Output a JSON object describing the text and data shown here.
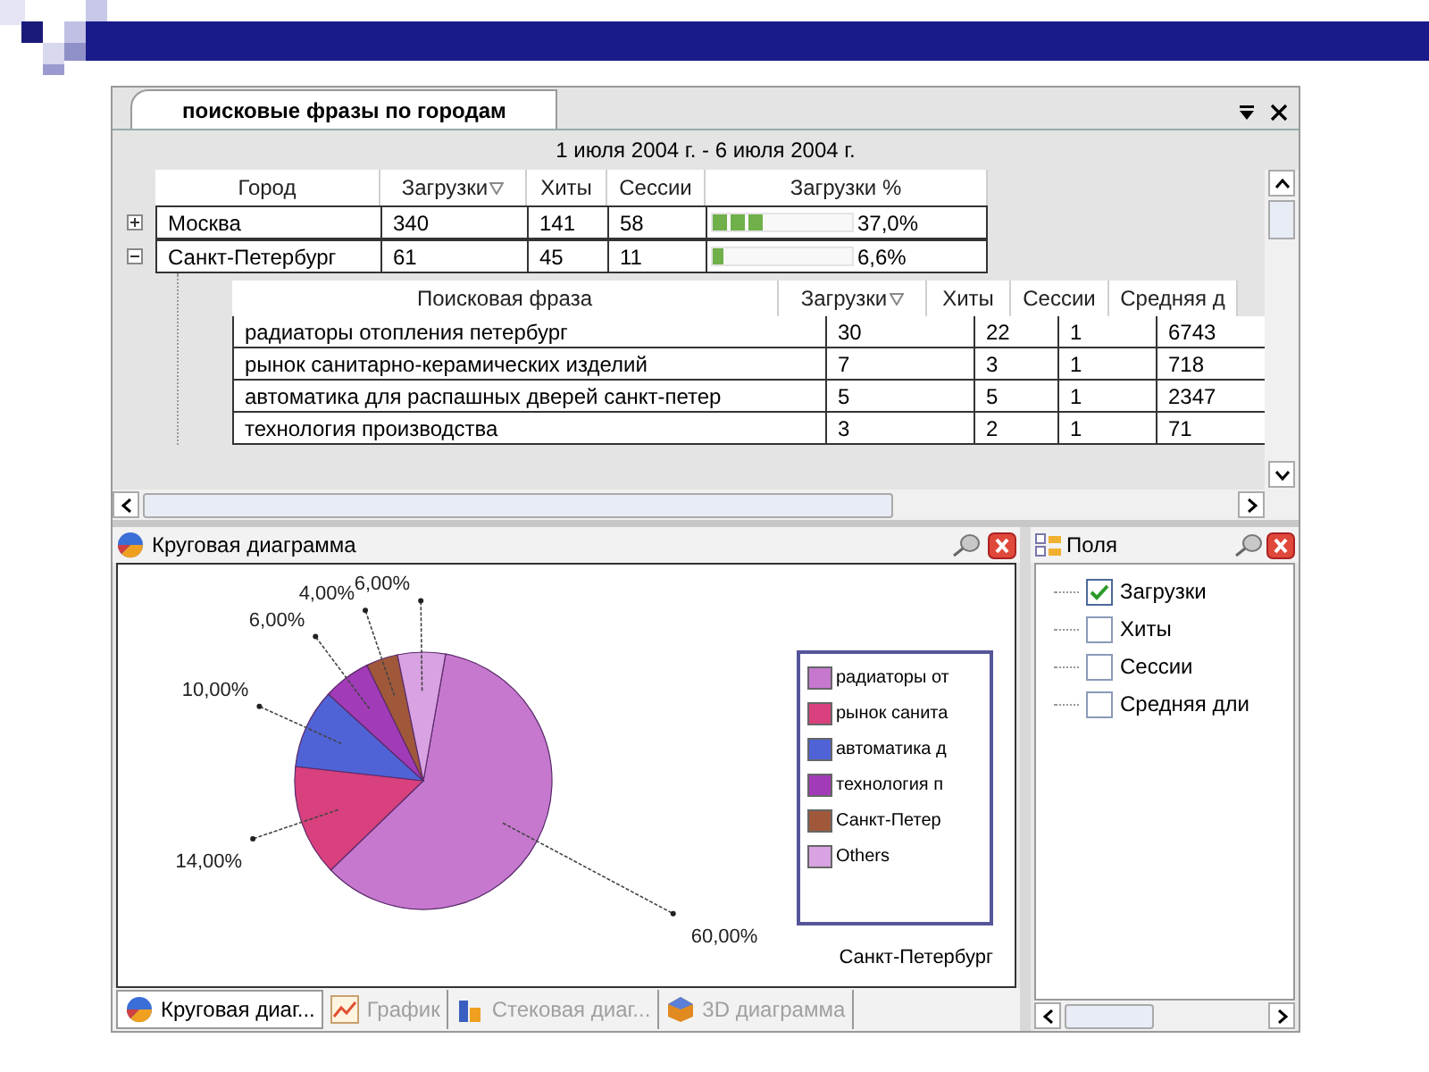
{
  "report": {
    "title": "поисковые фразы по городам",
    "date_range": "1 июля 2004 г. - 6 июля 2004 г.",
    "columns": [
      {
        "label": "Город",
        "sorted": false
      },
      {
        "label": "Загрузки",
        "sorted": true
      },
      {
        "label": "Хиты",
        "sorted": false
      },
      {
        "label": "Сессии",
        "sorted": false
      },
      {
        "label": "Загрузки %",
        "sorted": false
      }
    ],
    "rows": [
      {
        "expanded": false,
        "city": "Москва",
        "downloads": "340",
        "hits": "141",
        "sessions": "58",
        "level": 0.37,
        "percent": "37,0%"
      },
      {
        "expanded": true,
        "city": "Санкт-Петербург",
        "downloads": "61",
        "hits": "45",
        "sessions": "11",
        "level": 0.066,
        "percent": "6,6%"
      }
    ],
    "detail": {
      "columns": [
        {
          "label": "Поисковая фраза",
          "sorted": false
        },
        {
          "label": "Загрузки",
          "sorted": true
        },
        {
          "label": "Хиты",
          "sorted": false
        },
        {
          "label": "Сессии",
          "sorted": false
        },
        {
          "label": "Средняя д",
          "sorted": false
        }
      ],
      "rows": [
        {
          "phrase": "радиаторы отопления петербург",
          "downloads": "30",
          "hits": "22",
          "sessions": "1",
          "average": "6743"
        },
        {
          "phrase": "рынок санитарно-керамических изделий",
          "downloads": "7",
          "hits": "3",
          "sessions": "1",
          "average": "718"
        },
        {
          "phrase": "автоматика для распашных дверей санкт-петер",
          "downloads": "5",
          "hits": "5",
          "sessions": "1",
          "average": "2347"
        },
        {
          "phrase": "технология производства",
          "downloads": "3",
          "hits": "2",
          "sessions": "1",
          "average": "71"
        }
      ]
    }
  },
  "chart_panel": {
    "title": "Круговая диаграмма",
    "chart_data": {
      "type": "pie",
      "title": "Санкт-Петербург",
      "categories": [
        "радиаторы от",
        "рынок санита",
        "автоматика д",
        "технология п",
        "Санкт-Петер",
        "Others"
      ],
      "values": [
        60,
        14,
        10,
        6,
        4,
        6
      ],
      "value_labels": [
        "60,00%",
        "14,00%",
        "10,00%",
        "6,00%",
        "4,00%",
        "6,00%"
      ],
      "colors": [
        "#c678cf",
        "#d8407e",
        "#4f63d6",
        "#a23bb8",
        "#a0583a",
        "#d9a2e2"
      ],
      "legend": "right"
    },
    "tabs": [
      {
        "label": "Круговая диаг...",
        "selected": true
      },
      {
        "label": "График",
        "selected": false
      },
      {
        "label": "Стековая диаг...",
        "selected": false
      },
      {
        "label": "3D диаграмма",
        "selected": false
      }
    ]
  },
  "fields_panel": {
    "title": "Поля",
    "items": [
      {
        "label": "Загрузки",
        "checked": true
      },
      {
        "label": "Хиты",
        "checked": false
      },
      {
        "label": "Сессии",
        "checked": false
      },
      {
        "label": "Средняя дли",
        "checked": false
      }
    ]
  }
}
